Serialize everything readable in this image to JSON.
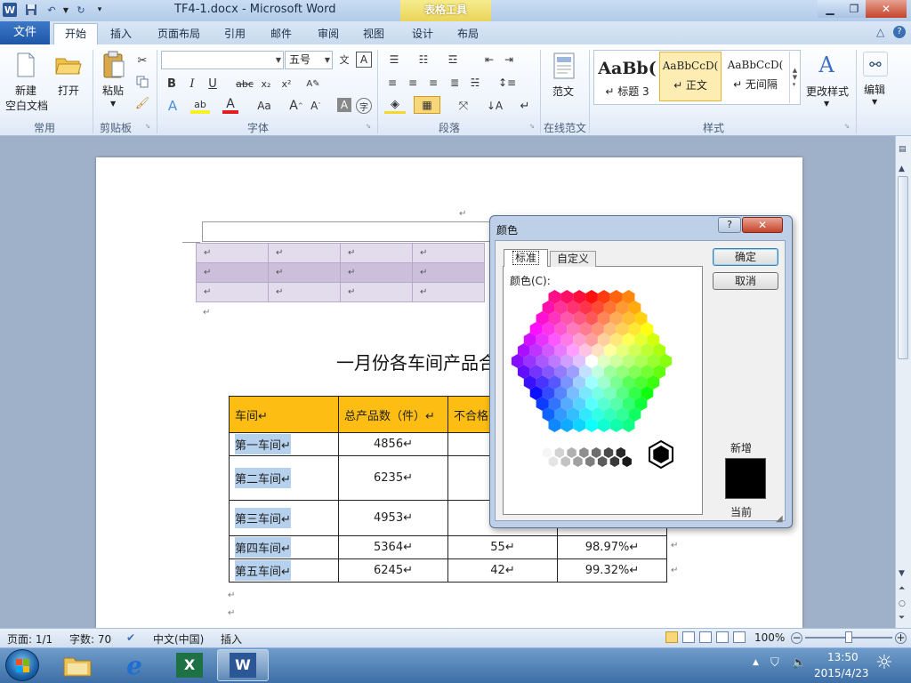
{
  "window": {
    "doc_title": "TF4-1.docx - Microsoft Word",
    "context_tab_group": "表格工具"
  },
  "tabs": {
    "file": "文件",
    "home": "开始",
    "insert": "插入",
    "page_layout": "页面布局",
    "references": "引用",
    "mailings": "邮件",
    "review": "审阅",
    "view": "视图",
    "design": "设计",
    "layout": "布局"
  },
  "ribbon": {
    "common": {
      "new_line1": "新建",
      "new_line2": "空白文档",
      "open": "打开",
      "label": "常用"
    },
    "clipboard": {
      "paste": "粘贴",
      "label": "剪贴板"
    },
    "font": {
      "name_value": "",
      "size_value": "五号",
      "label": "字体"
    },
    "paragraph": {
      "label": "段落"
    },
    "online": {
      "fanwen": "范文",
      "label": "在线范文"
    },
    "styles": {
      "items": [
        {
          "sample": "AaBb(",
          "name": "↵ 标题 3"
        },
        {
          "sample": "AaBbCcD(",
          "name": "↵ 正文"
        },
        {
          "sample": "AaBbCcD(",
          "name": "↵ 无间隔"
        }
      ],
      "change": "更改样式",
      "label": "样式"
    },
    "editing": {
      "label": "编辑"
    }
  },
  "document": {
    "heading": "一月份各车间产品合格",
    "table": {
      "headers": [
        "车间↵",
        "总产品数（件）↵",
        "不合格",
        ""
      ],
      "rows": [
        [
          "第一车间↵",
          "4856↵",
          "",
          ""
        ],
        [
          "第二车间↵",
          "6235↵",
          "",
          ""
        ],
        [
          "第三车间↵",
          "4953↵",
          "",
          ""
        ],
        [
          "第四车间↵",
          "5364↵",
          "55↵",
          "98.97%↵"
        ],
        [
          "第五车间↵",
          "6245↵",
          "42↵",
          "99.32%↵"
        ]
      ]
    }
  },
  "dialog": {
    "title": "颜色",
    "tab_standard": "标准",
    "tab_custom": "自定义",
    "colors_label": "颜色(C):",
    "ok": "确定",
    "cancel": "取消",
    "new_label": "新增",
    "current_label": "当前",
    "selected_color": "#000000"
  },
  "statusbar": {
    "page": "页面: 1/1",
    "words": "字数: 70",
    "language": "中文(中国)",
    "mode": "插入",
    "zoom": "100%"
  },
  "taskbar": {
    "time": "13:50",
    "date": "2015/4/23"
  }
}
